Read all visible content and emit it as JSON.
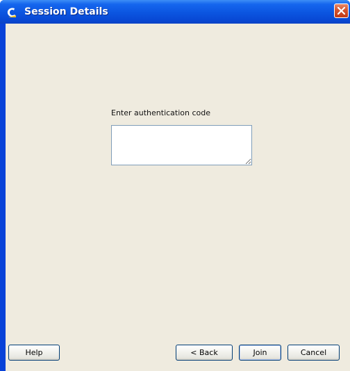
{
  "window": {
    "title": "Session Details",
    "icon": "app-c-icon",
    "close_icon": "close-icon"
  },
  "form": {
    "prompt_label": "Enter authentication code",
    "code_value": "",
    "code_placeholder": ""
  },
  "buttons": {
    "help": "Help",
    "back": "< Back",
    "join": "Join",
    "cancel": "Cancel"
  },
  "colors": {
    "titlebar": "#0b55e0",
    "client_bg": "#efebdf",
    "close_button": "#d4532e",
    "input_border": "#7f9db9"
  }
}
